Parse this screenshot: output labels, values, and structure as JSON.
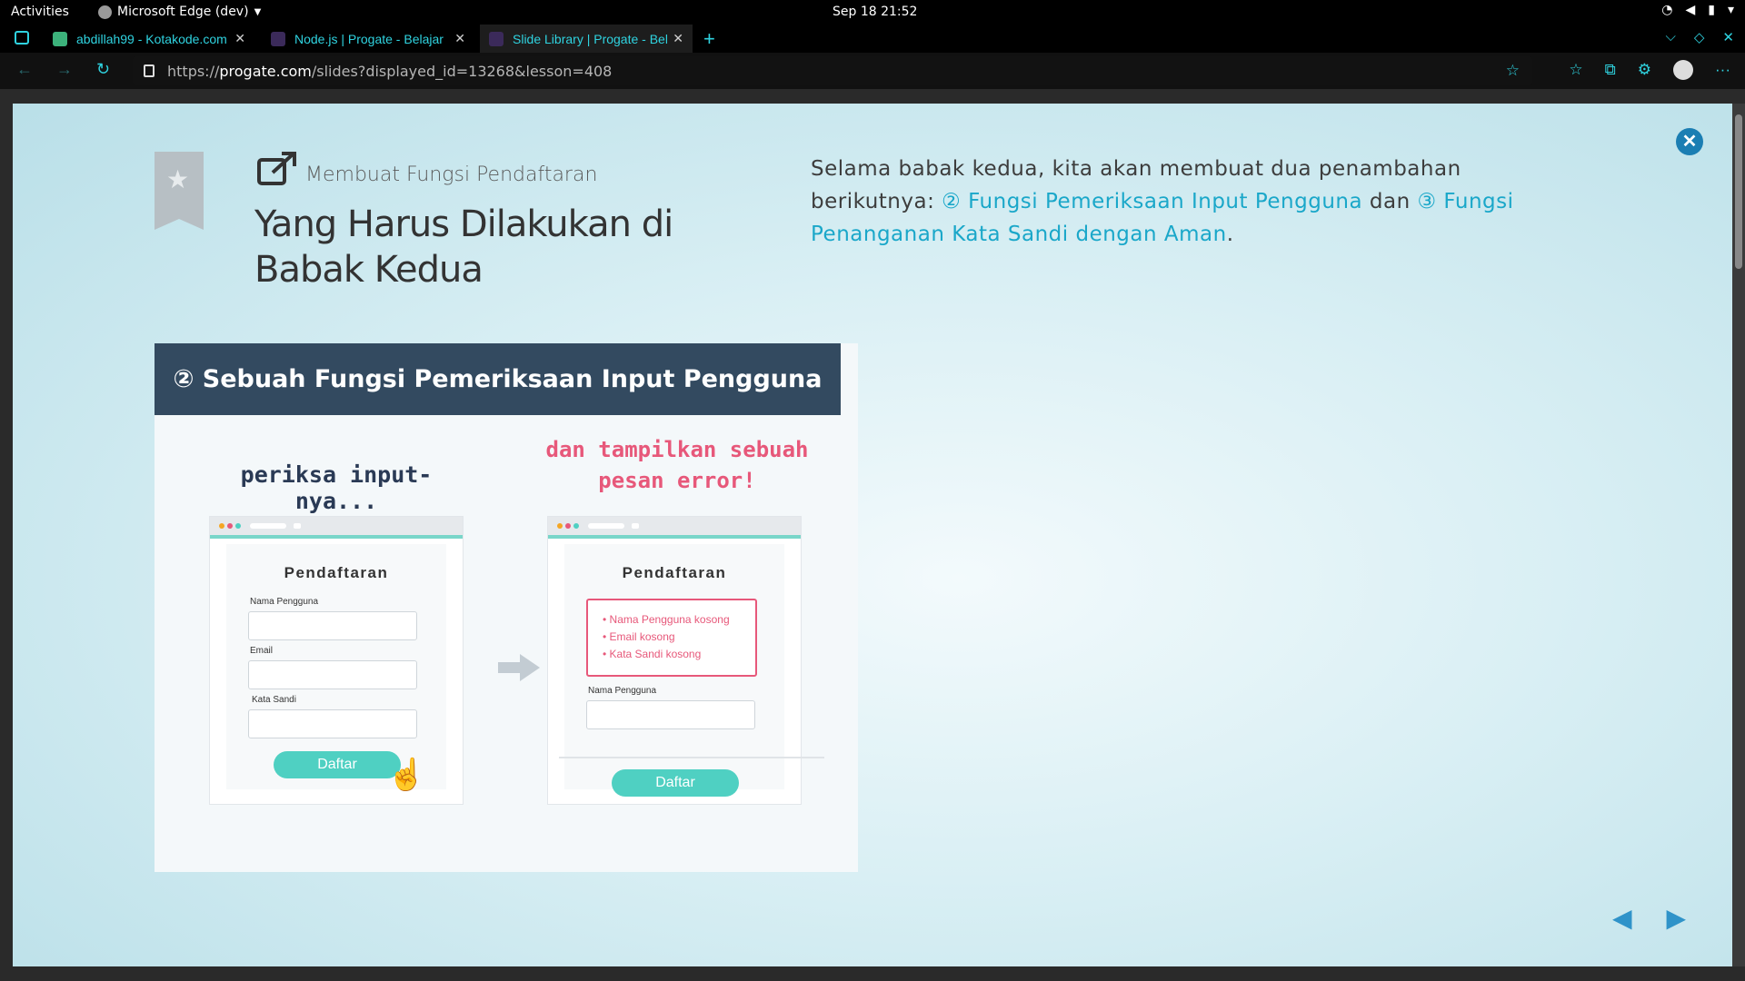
{
  "system": {
    "activities": "Activities",
    "app_name": "Microsoft Edge (dev)",
    "clock": "Sep 18  21:52"
  },
  "browser": {
    "tabs": [
      {
        "title": "abdillah99 - Kotakode.com",
        "active": false
      },
      {
        "title": "Node.js | Progate - Belajar",
        "active": false
      },
      {
        "title": "Slide Library | Progate - Belajar",
        "active": true
      }
    ],
    "url_prefix": "https://",
    "url_host": "progate.com",
    "url_path": "/slides?displayed_id=13268&lesson=408",
    "accent_color": "#2fd3e0"
  },
  "slide": {
    "subtitle": "Membuat Fungsi Pendaftaran",
    "title": "Yang Harus Dilakukan di Babak Kedua",
    "desc_intro": "Selama babak kedua, kita akan membuat dua penambahan berikutnya: ",
    "desc_link1": "② Fungsi Pemeriksaan Input Pengguna",
    "desc_mid": " dan ",
    "desc_link2": "③ Fungsi Penanganan Kata Sandi dengan Aman",
    "desc_end": ".",
    "figure": {
      "header": "② Sebuah Fungsi Pemeriksaan Input Pengguna",
      "caption_left": "periksa input-nya...",
      "caption_right_1": "dan tampilkan sebuah",
      "caption_right_2": "pesan error!",
      "left_form": {
        "title": "Pendaftaran",
        "label_username": "Nama Pengguna",
        "label_email": "Email",
        "label_password": "Kata Sandi",
        "button": "Daftar"
      },
      "right_form": {
        "title": "Pendaftaran",
        "errors": [
          "• Nama Pengguna kosong",
          "• Email kosong",
          "• Kata Sandi kosong"
        ],
        "label_username": "Nama Pengguna",
        "button": "Daftar"
      }
    },
    "close_icon": "close-icon",
    "prev_icon": "◀",
    "next_icon": "▶"
  }
}
